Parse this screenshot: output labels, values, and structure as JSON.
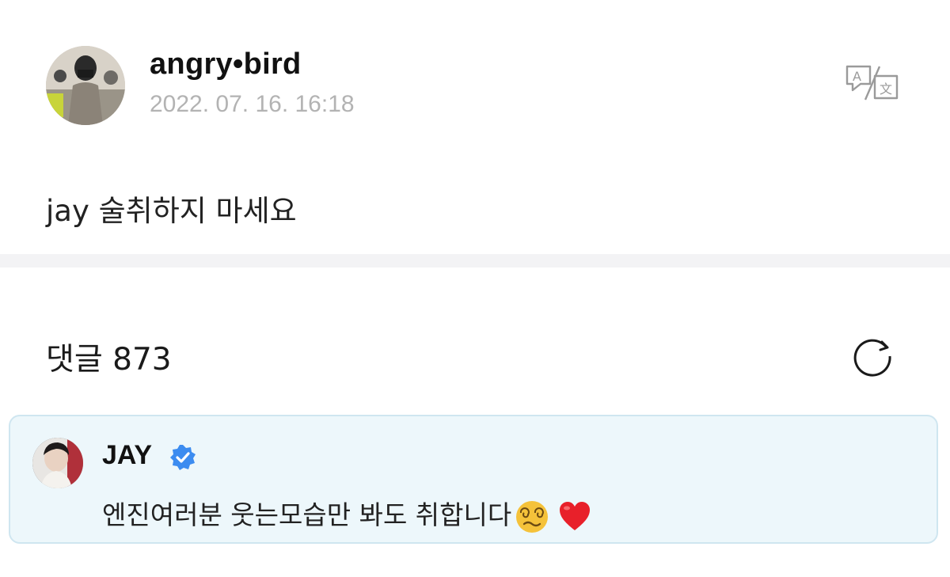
{
  "post": {
    "author": "angry•bird",
    "timestamp": "2022. 07. 16. 16:18",
    "body": "jay 술취하지 마세요",
    "translate_icon": "translate-icon"
  },
  "comments": {
    "label": "댓글 873",
    "refresh_icon": "refresh-icon"
  },
  "artist_comment": {
    "author": "JAY",
    "verified_icon": "verified-badge-icon",
    "text": "엔진여러분 웃는모습만 봐도 취합니다",
    "emojis": [
      "dizzy-face-emoji",
      "red-heart-emoji"
    ]
  },
  "colors": {
    "timestamp": "#b3b3b3",
    "divider": "#f3f3f5",
    "artist_bg": "#edf7fb",
    "artist_border": "#cfe6f0",
    "verified": "#3c8cf0"
  }
}
